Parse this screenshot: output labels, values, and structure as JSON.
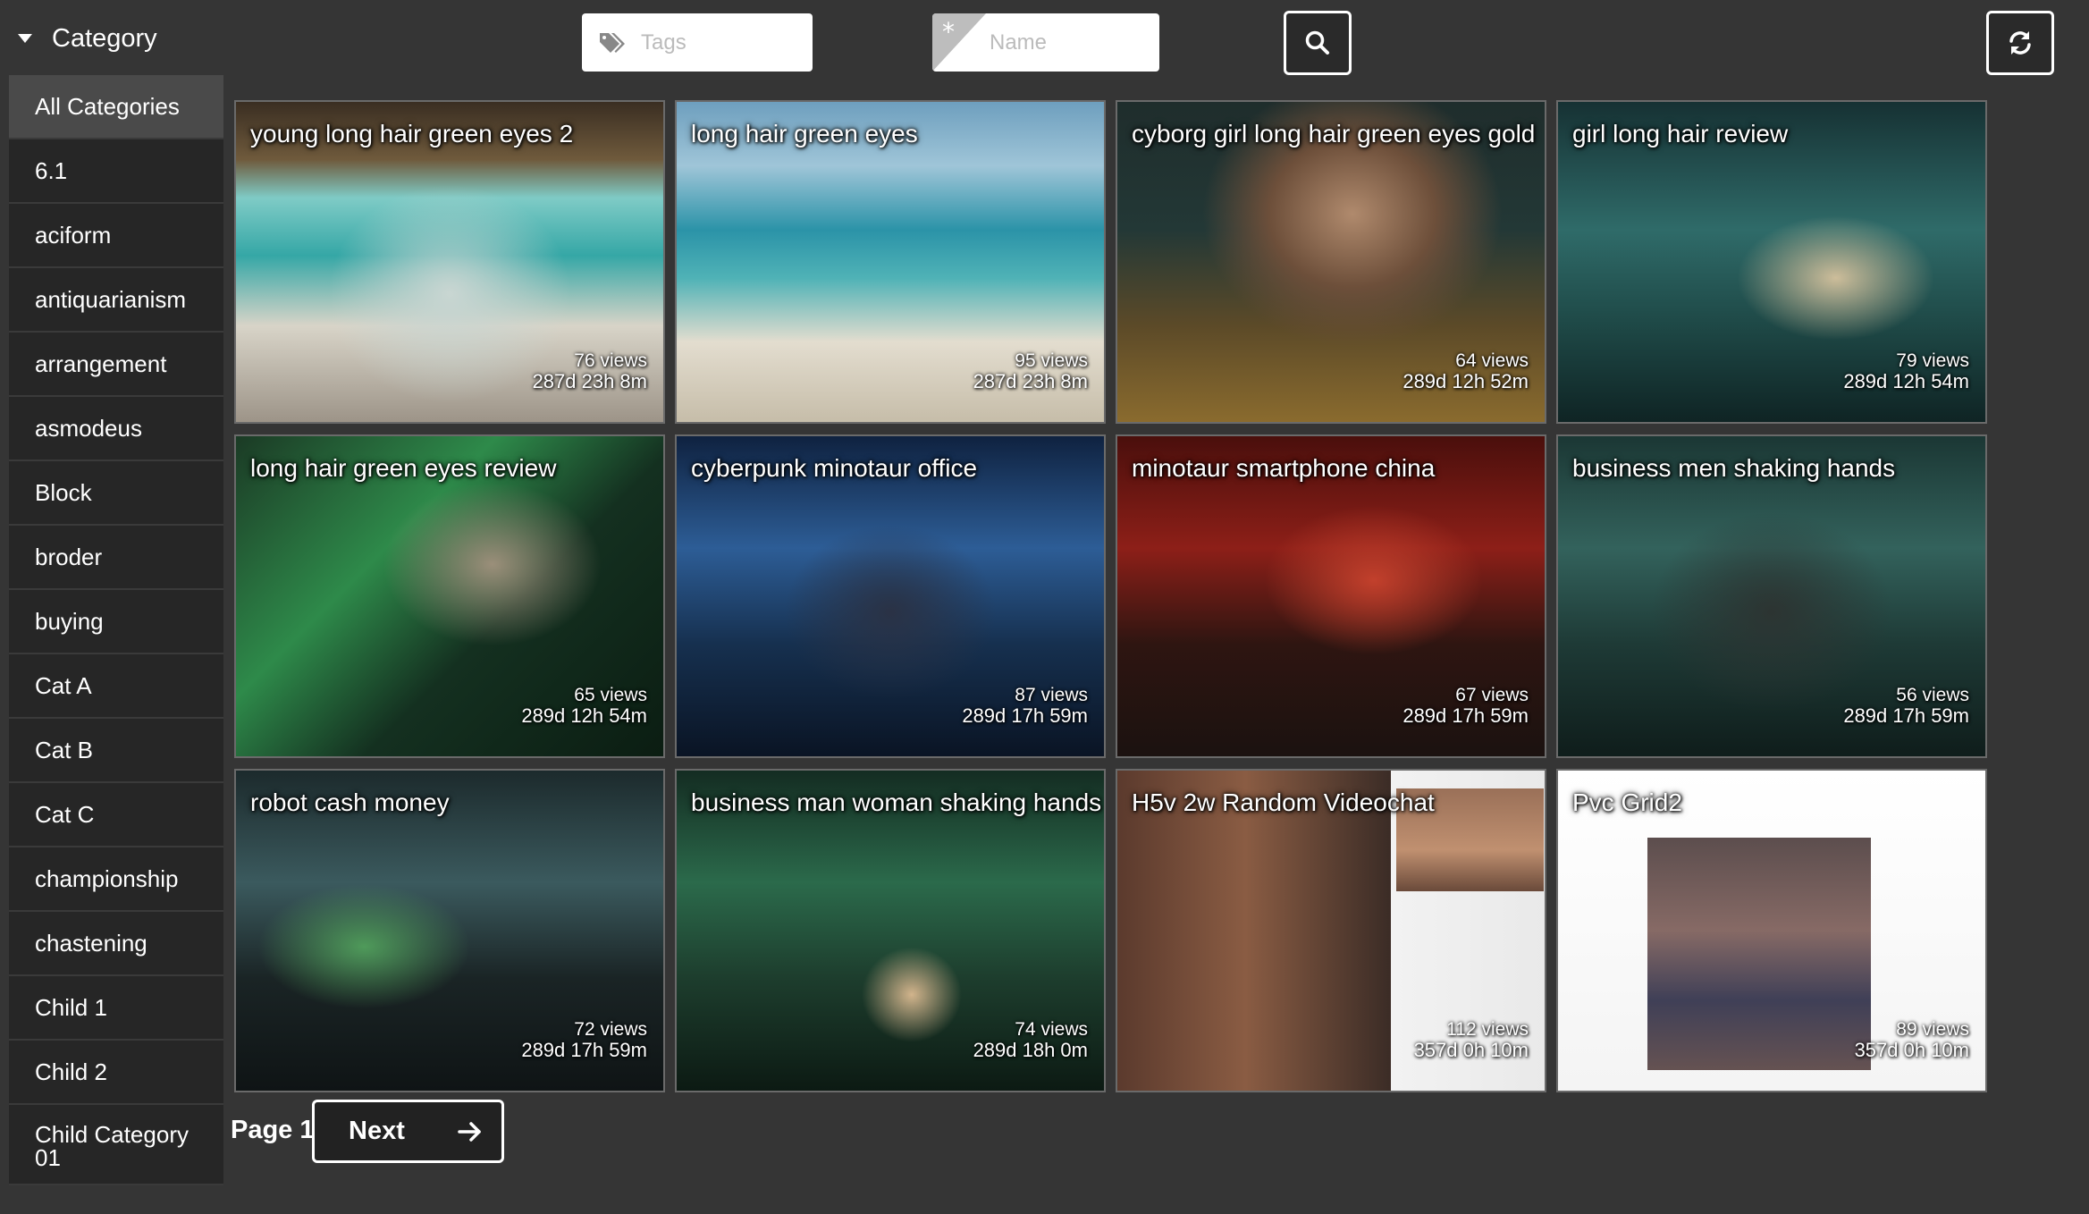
{
  "sidebar": {
    "header": "Category",
    "items": [
      {
        "label": "All Categories",
        "active": true
      },
      {
        "label": "6.1"
      },
      {
        "label": "aciform"
      },
      {
        "label": "antiquarianism"
      },
      {
        "label": "arrangement"
      },
      {
        "label": "asmodeus"
      },
      {
        "label": "Block"
      },
      {
        "label": "broder"
      },
      {
        "label": "buying"
      },
      {
        "label": "Cat A"
      },
      {
        "label": "Cat B"
      },
      {
        "label": "Cat C"
      },
      {
        "label": "championship"
      },
      {
        "label": "chastening"
      },
      {
        "label": "Child 1"
      },
      {
        "label": "Child 2"
      },
      {
        "label": "Child Category 01"
      }
    ]
  },
  "search": {
    "tags_placeholder": "Tags",
    "name_placeholder": "Name",
    "asterisk": "*"
  },
  "videos": [
    {
      "title": "young long hair green eyes 2",
      "views": "76 views",
      "age": "287d 23h 8m",
      "theme": "beach"
    },
    {
      "title": "long hair green eyes",
      "views": "95 views",
      "age": "287d 23h 8m",
      "theme": "sea"
    },
    {
      "title": "cyborg girl long hair green eyes gold",
      "views": "64 views",
      "age": "289d 12h 52m",
      "theme": "gold"
    },
    {
      "title": "girl long hair review",
      "views": "79 views",
      "age": "289d 12h 54m",
      "theme": "teal"
    },
    {
      "title": "long hair green eyes review",
      "views": "65 views",
      "age": "289d 12h 54m",
      "theme": "green"
    },
    {
      "title": "cyberpunk minotaur office",
      "views": "87 views",
      "age": "289d 17h 59m",
      "theme": "blue"
    },
    {
      "title": "minotaur smartphone china",
      "views": "67 views",
      "age": "289d 17h 59m",
      "theme": "red"
    },
    {
      "title": "business men shaking hands",
      "views": "56 views",
      "age": "289d 17h 59m",
      "theme": "office"
    },
    {
      "title": "robot cash money",
      "views": "72 views",
      "age": "289d 17h 59m",
      "theme": "robot"
    },
    {
      "title": "business man woman shaking hands",
      "views": "74 views",
      "age": "289d 18h 0m",
      "theme": "stocks"
    },
    {
      "title": "H5v 2w Random Videochat",
      "views": "112 views",
      "age": "357d 0h 10m",
      "theme": "chat"
    },
    {
      "title": "Pvc Grid2",
      "views": "89 views",
      "age": "357d 0h 10m",
      "theme": "white"
    }
  ],
  "pagination": {
    "page_label": "Page 1",
    "next_label": "Next"
  },
  "colors": {
    "background": "#353535",
    "sidebar_item": "#262626",
    "sidebar_active": "#4a4a4a"
  }
}
